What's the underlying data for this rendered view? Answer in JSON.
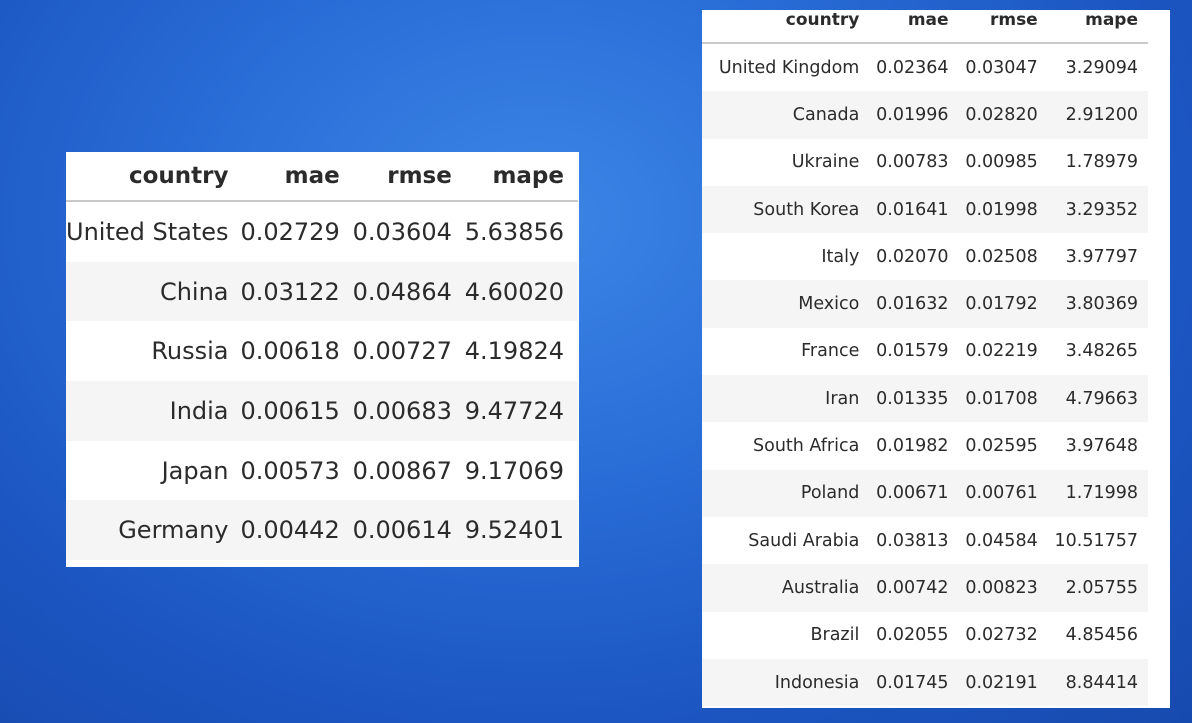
{
  "colors": {
    "background": "#2565d0",
    "panel": "#ffffff",
    "row_stripe": "#f5f5f5"
  },
  "left_table": {
    "headers": [
      "country",
      "mae",
      "rmse",
      "mape"
    ],
    "rows": [
      [
        "United States",
        "0.02729",
        "0.03604",
        "5.63856"
      ],
      [
        "China",
        "0.03122",
        "0.04864",
        "4.60020"
      ],
      [
        "Russia",
        "0.00618",
        "0.00727",
        "4.19824"
      ],
      [
        "India",
        "0.00615",
        "0.00683",
        "9.47724"
      ],
      [
        "Japan",
        "0.00573",
        "0.00867",
        "9.17069"
      ],
      [
        "Germany",
        "0.00442",
        "0.00614",
        "9.52401"
      ]
    ]
  },
  "right_table": {
    "headers": [
      "country",
      "mae",
      "rmse",
      "mape"
    ],
    "rows": [
      [
        "United Kingdom",
        "0.02364",
        "0.03047",
        "3.29094"
      ],
      [
        "Canada",
        "0.01996",
        "0.02820",
        "2.91200"
      ],
      [
        "Ukraine",
        "0.00783",
        "0.00985",
        "1.78979"
      ],
      [
        "South Korea",
        "0.01641",
        "0.01998",
        "3.29352"
      ],
      [
        "Italy",
        "0.02070",
        "0.02508",
        "3.97797"
      ],
      [
        "Mexico",
        "0.01632",
        "0.01792",
        "3.80369"
      ],
      [
        "France",
        "0.01579",
        "0.02219",
        "3.48265"
      ],
      [
        "Iran",
        "0.01335",
        "0.01708",
        "4.79663"
      ],
      [
        "South Africa",
        "0.01982",
        "0.02595",
        "3.97648"
      ],
      [
        "Poland",
        "0.00671",
        "0.00761",
        "1.71998"
      ],
      [
        "Saudi Arabia",
        "0.03813",
        "0.04584",
        "10.51757"
      ],
      [
        "Australia",
        "0.00742",
        "0.00823",
        "2.05755"
      ],
      [
        "Brazil",
        "0.02055",
        "0.02732",
        "4.85456"
      ],
      [
        "Indonesia",
        "0.01745",
        "0.02191",
        "8.84414"
      ]
    ]
  }
}
